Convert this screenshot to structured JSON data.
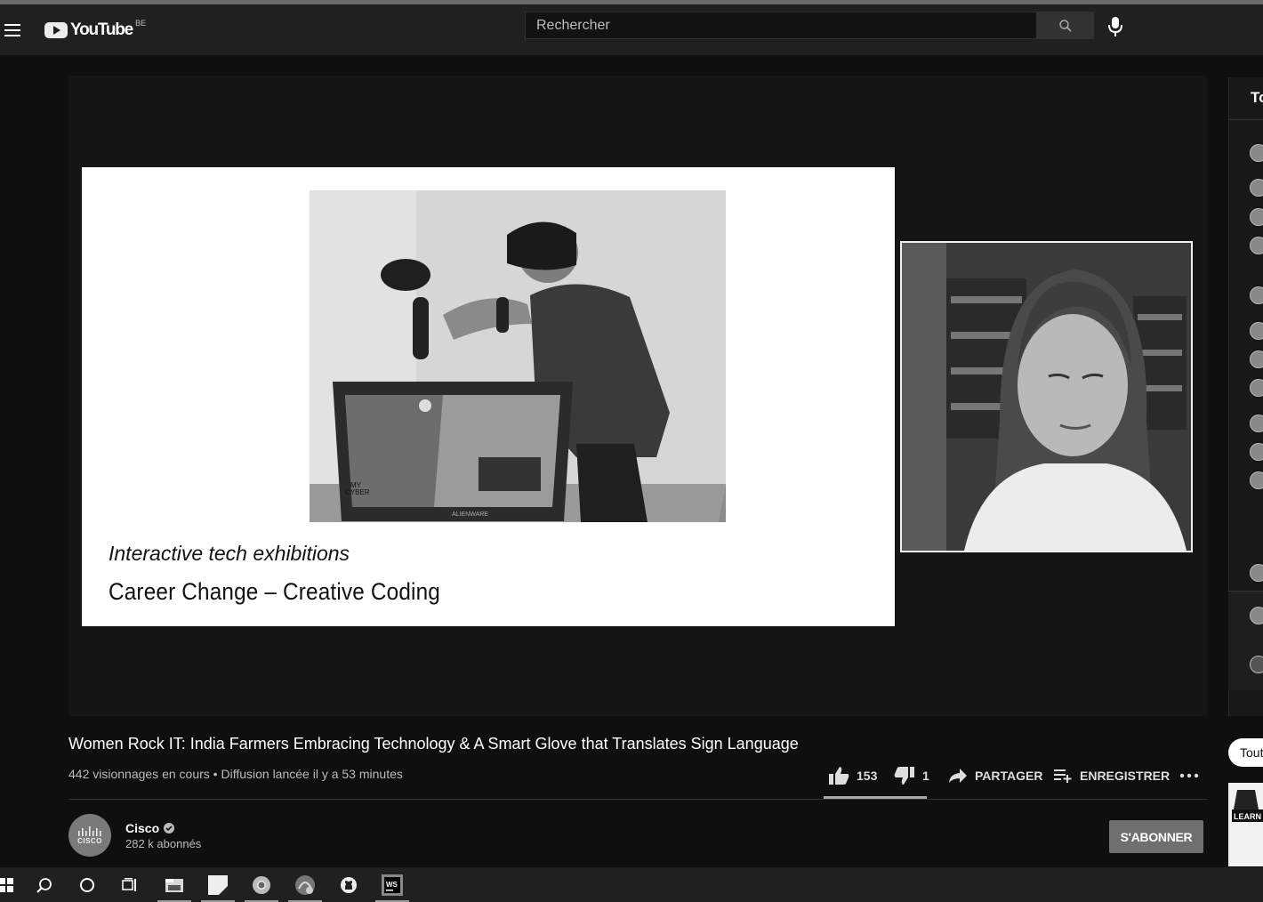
{
  "header": {
    "logo_text": "YouTube",
    "country_code": "BE",
    "search_placeholder": "Rechercher",
    "icons": [
      "menu-icon",
      "search-icon",
      "mic-icon"
    ]
  },
  "player": {
    "slide_subtitle": "Interactive tech exhibitions",
    "slide_title": "Career Change – Creative Coding",
    "laptop_brand": "ALIENWARE",
    "screen_logo_text": "MY\nCYBER"
  },
  "chat": {
    "header_label": "To",
    "filter_chip": "Tout"
  },
  "video": {
    "title": "Women Rock IT: India Farmers Embracing Technology & A Smart Glove that Translates Sign Language",
    "views": "442 visionnages en cours",
    "separator": "•",
    "started": "Diffusion lancée il y a 53 minutes",
    "likes": "153",
    "dislikes": "1",
    "share_label": "PARTAGER",
    "save_label": "ENREGISTRER"
  },
  "channel": {
    "name": "Cisco",
    "avatar_text": "CISCO",
    "subscribers": "282 k abonnés",
    "subscribe_label": "S'ABONNER"
  },
  "recommendation": {
    "thumb_text": "LEARN"
  },
  "taskbar": {
    "icons": [
      "windows-icon",
      "search-icon",
      "cortana-icon",
      "task-view-icon",
      "file-explorer-icon",
      "sticky-notes-icon",
      "chrome-icon",
      "app-icon",
      "github-icon",
      "webstorm-icon"
    ],
    "webstorm_text": "WS"
  },
  "colors": {
    "background": "#0f0f0f",
    "masthead": "#202020",
    "subscribe_button": "#6f6f6f"
  }
}
